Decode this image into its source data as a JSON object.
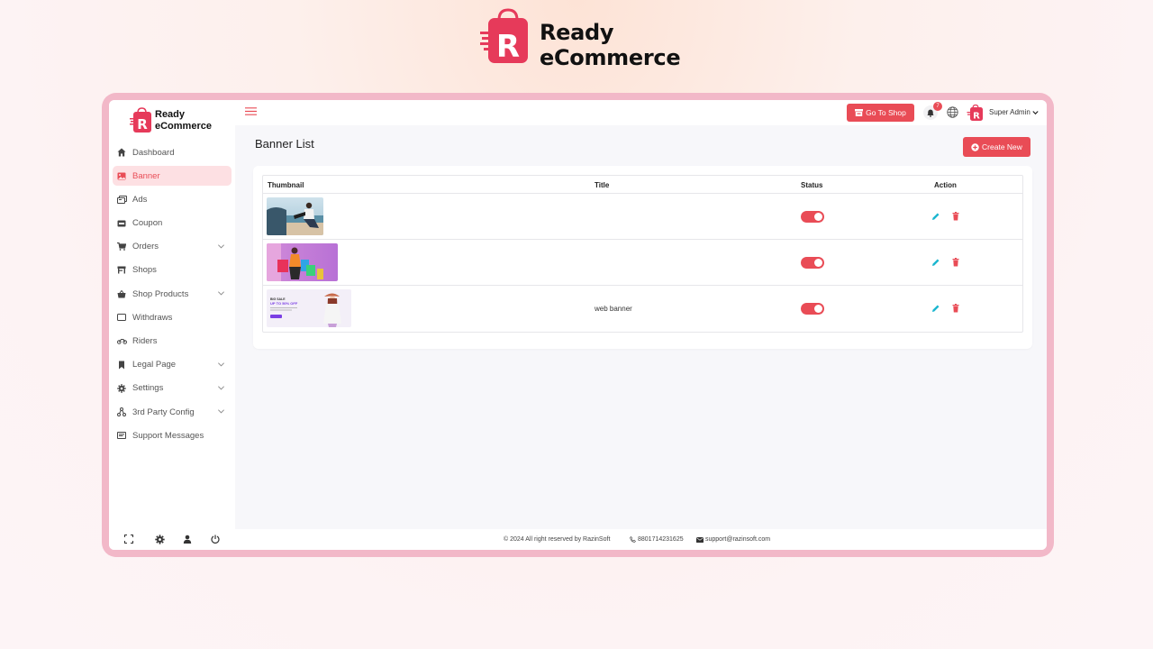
{
  "brand": {
    "line1": "Ready",
    "line2": "eCommerce",
    "logo_letter": "R"
  },
  "colors": {
    "accent": "#e94c56",
    "frame": "#f2b8c8",
    "edit_icon": "#1ab6cf"
  },
  "header": {
    "go_to_shop": "Go To Shop",
    "notification_count": "7",
    "user_name": "Super Admin"
  },
  "sidebar": {
    "items": [
      {
        "label": "Dashboard",
        "icon": "home-icon"
      },
      {
        "label": "Banner",
        "icon": "image-icon",
        "active": true
      },
      {
        "label": "Ads",
        "icon": "ads-icon"
      },
      {
        "label": "Coupon",
        "icon": "coupon-icon"
      },
      {
        "label": "Orders",
        "icon": "cart-icon",
        "expandable": true
      },
      {
        "label": "Shops",
        "icon": "store-icon"
      },
      {
        "label": "Shop Products",
        "icon": "basket-icon",
        "expandable": true
      },
      {
        "label": "Withdraws",
        "icon": "wallet-icon"
      },
      {
        "label": "Riders",
        "icon": "bike-icon"
      },
      {
        "label": "Legal Page",
        "icon": "bookmark-icon",
        "expandable": true
      },
      {
        "label": "Settings",
        "icon": "gear-icon",
        "expandable": true
      },
      {
        "label": "3rd Party Config",
        "icon": "network-icon",
        "expandable": true
      },
      {
        "label": "Support Messages",
        "icon": "message-icon"
      }
    ],
    "bottom_icons": [
      "fullscreen-icon",
      "gear-icon",
      "user-icon",
      "power-icon"
    ]
  },
  "main": {
    "title": "Banner List",
    "create_button": "Create New",
    "table": {
      "columns": [
        "Thumbnail",
        "Title",
        "Status",
        "Action"
      ],
      "rows": [
        {
          "thumbnail": "banner-beach-man",
          "title": "",
          "status": true
        },
        {
          "thumbnail": "banner-shopping-woman",
          "title": "",
          "status": true
        },
        {
          "thumbnail": "banner-web-sale",
          "title": "web banner",
          "status": true,
          "thumb_text1": "BIG SALE",
          "thumb_text2": "UP TO 50% OFF"
        }
      ]
    }
  },
  "footer": {
    "copyright": "© 2024 All right reserved by RazinSoft",
    "phone": "8801714231625",
    "email": "support@razinsoft.com"
  }
}
